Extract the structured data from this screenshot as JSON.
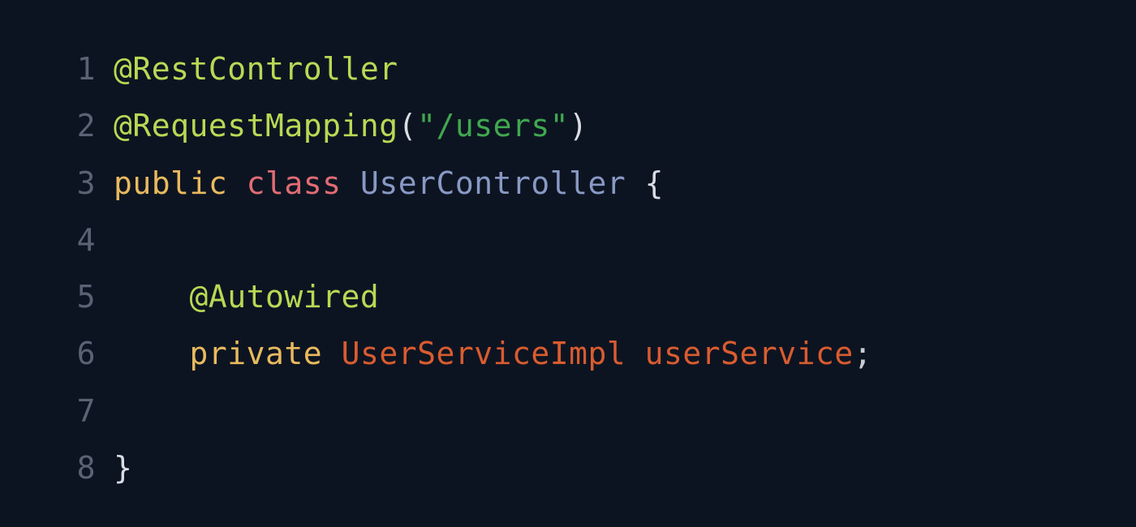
{
  "code": {
    "lines": [
      {
        "num": "1",
        "tokens": [
          {
            "cls": "annotation",
            "text": "@RestController"
          }
        ]
      },
      {
        "num": "2",
        "tokens": [
          {
            "cls": "annotation",
            "text": "@RequestMapping"
          },
          {
            "cls": "paren",
            "text": "("
          },
          {
            "cls": "string",
            "text": "\"/users\""
          },
          {
            "cls": "paren",
            "text": ")"
          }
        ]
      },
      {
        "num": "3",
        "tokens": [
          {
            "cls": "keyword-public",
            "text": "public"
          },
          {
            "cls": "punct",
            "text": " "
          },
          {
            "cls": "keyword-class",
            "text": "class"
          },
          {
            "cls": "punct",
            "text": " "
          },
          {
            "cls": "class-name",
            "text": "UserController"
          },
          {
            "cls": "punct",
            "text": " "
          },
          {
            "cls": "brace",
            "text": "{"
          }
        ]
      },
      {
        "num": "4",
        "tokens": []
      },
      {
        "num": "5",
        "tokens": [
          {
            "cls": "punct",
            "text": "    "
          },
          {
            "cls": "annotation",
            "text": "@Autowired"
          }
        ]
      },
      {
        "num": "6",
        "tokens": [
          {
            "cls": "punct",
            "text": "    "
          },
          {
            "cls": "keyword-private",
            "text": "private"
          },
          {
            "cls": "punct",
            "text": " "
          },
          {
            "cls": "type-name",
            "text": "UserServiceImpl"
          },
          {
            "cls": "punct",
            "text": " "
          },
          {
            "cls": "variable",
            "text": "userService"
          },
          {
            "cls": "punct",
            "text": ";"
          }
        ]
      },
      {
        "num": "7",
        "tokens": []
      },
      {
        "num": "8",
        "tokens": [
          {
            "cls": "brace",
            "text": "}"
          }
        ]
      }
    ]
  }
}
